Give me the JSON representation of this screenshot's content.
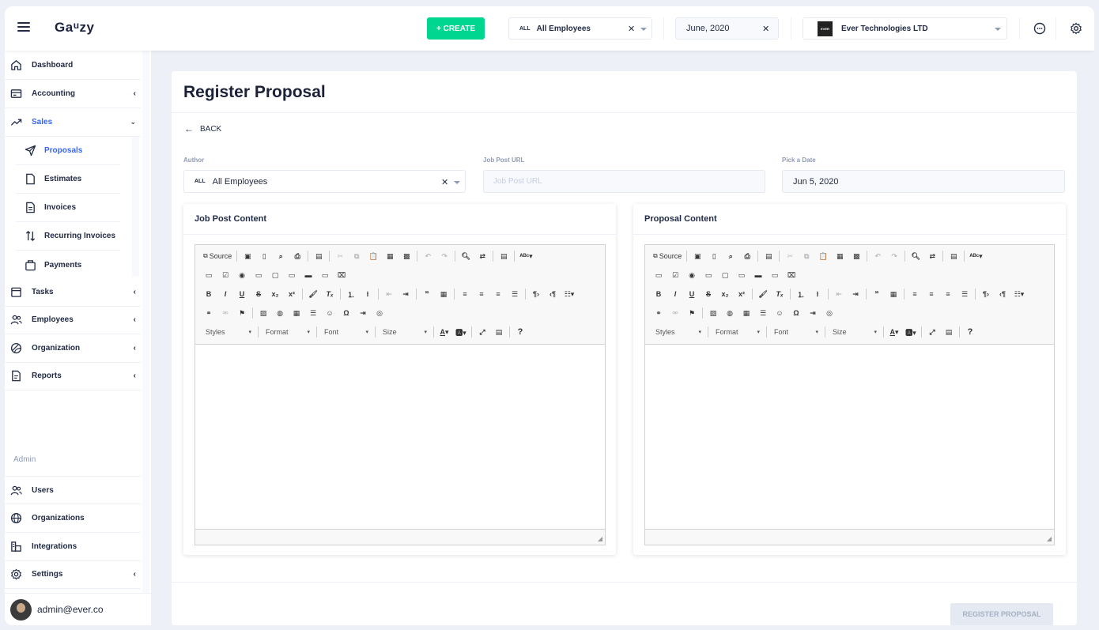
{
  "header": {
    "logo": "Ga🆄zy",
    "logo_text": "Gauzy",
    "create_label": "+ CREATE",
    "employee_select": {
      "tag": "ALL",
      "value": "All Employees"
    },
    "date_select": {
      "value": "June, 2020"
    },
    "org_select": {
      "value": "Ever Technologies LTD",
      "logo_text": "EVER"
    }
  },
  "sidebar": {
    "items": [
      {
        "label": "Dashboard",
        "icon": "home-icon"
      },
      {
        "label": "Accounting",
        "icon": "accounting-icon"
      },
      {
        "label": "Sales",
        "icon": "trending-up-icon"
      },
      {
        "label": "Tasks",
        "icon": "tasks-icon"
      },
      {
        "label": "Employees",
        "icon": "people-icon"
      },
      {
        "label": "Organization",
        "icon": "organization-icon"
      },
      {
        "label": "Reports",
        "icon": "reports-icon"
      }
    ],
    "sales_sub": [
      {
        "label": "Proposals",
        "icon": "paper-plane-icon"
      },
      {
        "label": "Estimates",
        "icon": "file-icon"
      },
      {
        "label": "Invoices",
        "icon": "invoice-icon"
      },
      {
        "label": "Recurring Invoices",
        "icon": "recurring-icon"
      },
      {
        "label": "Payments",
        "icon": "payments-icon"
      }
    ],
    "admin_label": "Admin",
    "admin_items": [
      {
        "label": "Users",
        "icon": "users-icon"
      },
      {
        "label": "Organizations",
        "icon": "globe-icon"
      },
      {
        "label": "Integrations",
        "icon": "integrations-icon"
      },
      {
        "label": "Settings",
        "icon": "settings-icon"
      }
    ],
    "user_email": "admin@ever.co"
  },
  "main": {
    "title": "Register Proposal",
    "back_label": "BACK",
    "author_label": "Author",
    "author_tag": "ALL",
    "author_value": "All Employees",
    "job_url_label": "Job Post URL",
    "job_url_placeholder": "Job Post URL",
    "date_label": "Pick a Date",
    "date_value": "Jun 5, 2020",
    "job_post_title": "Job Post Content",
    "proposal_title": "Proposal Content",
    "submit_label": "REGISTER PROPOSAL"
  },
  "editor_toolbar": {
    "source_label": "Source",
    "combos": [
      "Styles",
      "Format",
      "Font",
      "Size"
    ]
  }
}
